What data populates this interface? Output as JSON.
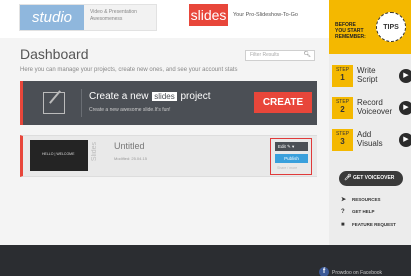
{
  "ads": {
    "studio_logo": "studio",
    "studio_text": "Video & Presentation Awesomeness",
    "slides_logo": "slides",
    "slides_tagline": "Your Pro-Slideshow-To-Go"
  },
  "dashboard": {
    "title": "Dashboard",
    "subtitle": "Here you can manage your projects, create new ones, and see your account stats",
    "filter_placeholder": "Filter Results"
  },
  "create": {
    "title_prefix": "Create a new",
    "title_brand": "slides",
    "title_suffix": "project",
    "description": "Create a new awesome slide.It's fun!",
    "button": "CREATE"
  },
  "project": {
    "thumb_text": "HELLO | WELCOME",
    "vertical_label": "Slides",
    "title": "Untitled",
    "modified": "Modified: 25.04.15",
    "edit_label": "Edit",
    "publish_label": "Publish",
    "share_label": "Share / more"
  },
  "sidebar": {
    "before_text_1": "BEFORE",
    "before_text_2": "YOU START",
    "before_text_3": "REMEMBER:",
    "tips_label": "TIPS",
    "steps": [
      {
        "step": "STEP",
        "num": "1",
        "label_1": "Write",
        "label_2": "Script"
      },
      {
        "step": "STEP",
        "num": "2",
        "label_1": "Record",
        "label_2": "Voiceover"
      },
      {
        "step": "STEP",
        "num": "3",
        "label_1": "Add",
        "label_2": "Visuals"
      }
    ],
    "voiceover_button": "GET VOICEOVER",
    "links": {
      "resources": "RESOURCES",
      "get_help": "GET HELP",
      "feature_request": "FEATURE REQUEST"
    }
  },
  "footer": {
    "facebook_text": "Prowdoo on Facebook"
  },
  "colors": {
    "accent_red": "#e8463a",
    "accent_yellow": "#f4b800",
    "publish_blue": "#3aa0dc"
  }
}
